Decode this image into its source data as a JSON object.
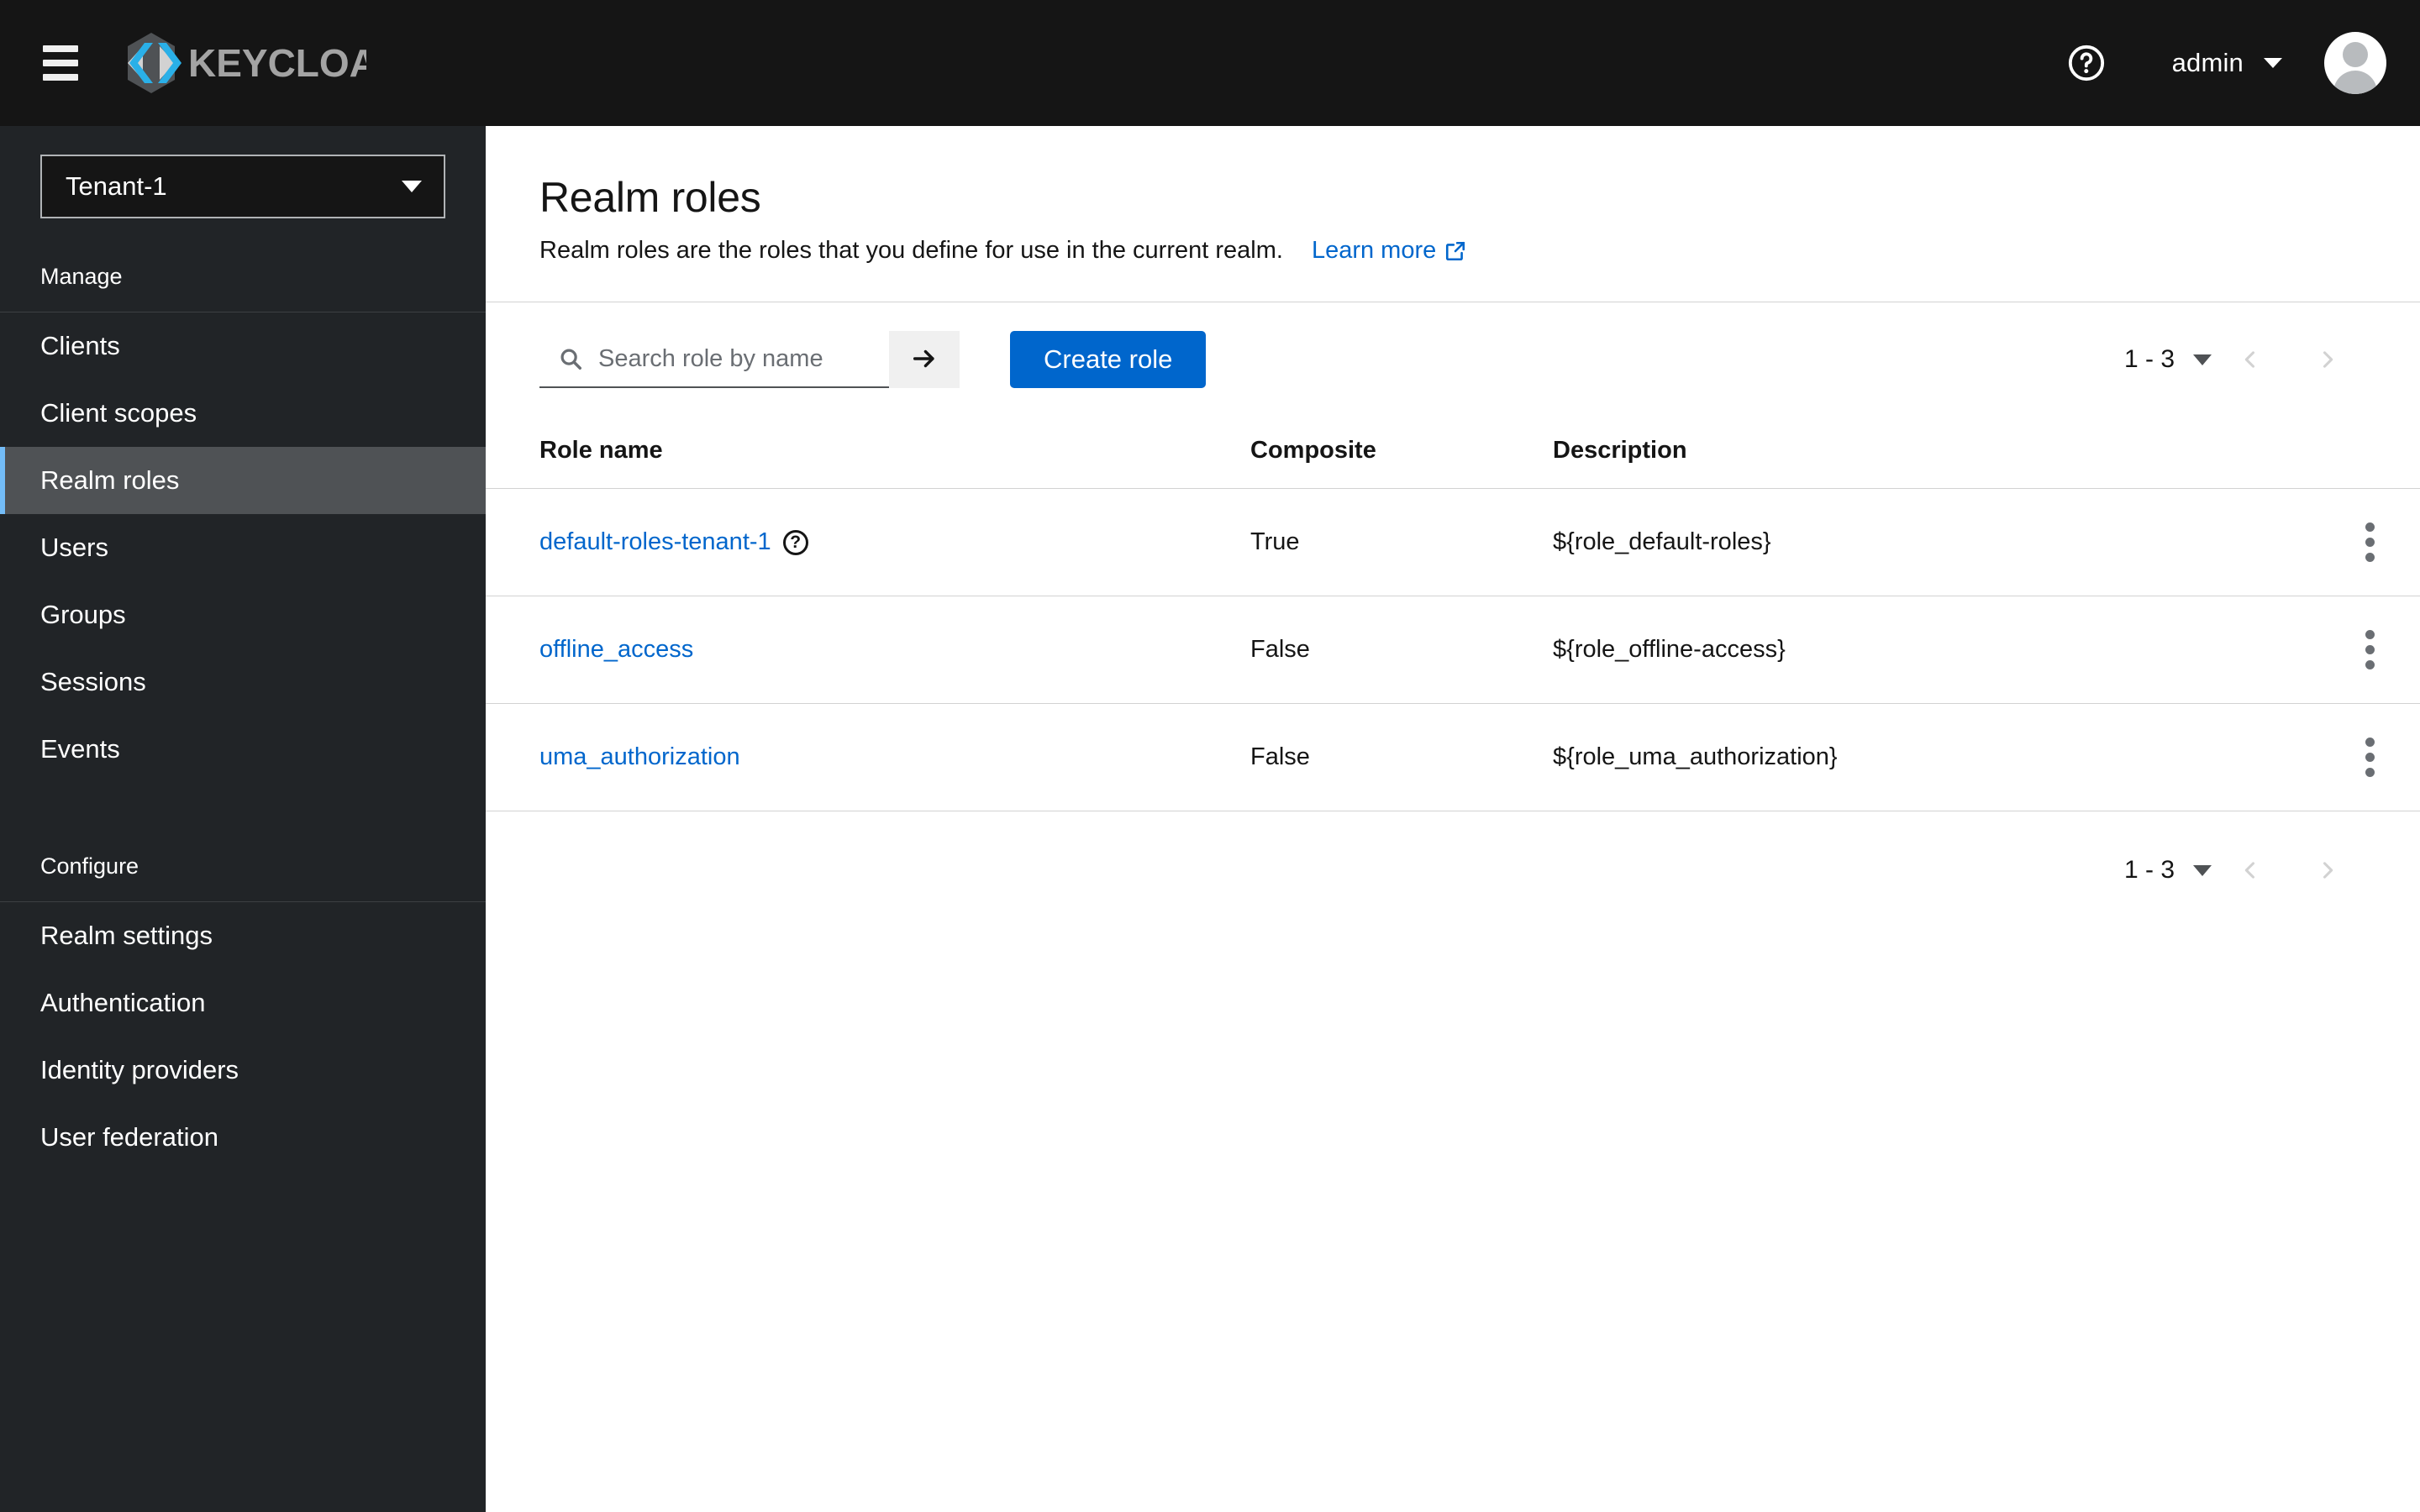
{
  "masthead": {
    "menu_toggle": "hamburger-menu",
    "brand_name": "KEYCLOAK",
    "help_label": "Help",
    "user_name": "admin",
    "avatar_label": "User avatar"
  },
  "sidebar": {
    "realm_selector": {
      "value": "Tenant-1"
    },
    "sections": [
      {
        "label": "Manage",
        "items": [
          {
            "label": "Clients",
            "active": false
          },
          {
            "label": "Client scopes",
            "active": false
          },
          {
            "label": "Realm roles",
            "active": true
          },
          {
            "label": "Users",
            "active": false
          },
          {
            "label": "Groups",
            "active": false
          },
          {
            "label": "Sessions",
            "active": false
          },
          {
            "label": "Events",
            "active": false
          }
        ]
      },
      {
        "label": "Configure",
        "items": [
          {
            "label": "Realm settings",
            "active": false
          },
          {
            "label": "Authentication",
            "active": false
          },
          {
            "label": "Identity providers",
            "active": false
          },
          {
            "label": "User federation",
            "active": false
          }
        ]
      }
    ]
  },
  "main": {
    "title": "Realm roles",
    "description": "Realm roles are the roles that you define for use in the current realm.",
    "learn_more": "Learn more",
    "toolbar": {
      "search_placeholder": "Search role by name",
      "search_value": "",
      "search_submit": "search-arrow",
      "create_label": "Create role"
    },
    "pagination_top": {
      "range": "1 - 3",
      "prev": "previous-page",
      "next": "next-page"
    },
    "pagination_bottom": {
      "range": "1 - 3",
      "prev": "previous-page",
      "next": "next-page"
    },
    "table": {
      "columns": [
        "Role name",
        "Composite",
        "Description"
      ],
      "rows": [
        {
          "name": "default-roles-tenant-1",
          "has_help": true,
          "composite": "True",
          "description": "${role_default-roles}"
        },
        {
          "name": "offline_access",
          "has_help": false,
          "composite": "False",
          "description": "${role_offline-access}"
        },
        {
          "name": "uma_authorization",
          "has_help": false,
          "composite": "False",
          "description": "${role_uma_authorization}"
        }
      ]
    }
  },
  "colors": {
    "masthead_bg": "#151515",
    "sidebar_bg": "#212427",
    "nav_active_bg": "#4f5255",
    "nav_active_accent": "#73bcf7",
    "primary_blue": "#0066cc",
    "link_blue": "#0066cc",
    "border_gray": "#d2d2d2",
    "muted_gray": "#6a6e73"
  }
}
